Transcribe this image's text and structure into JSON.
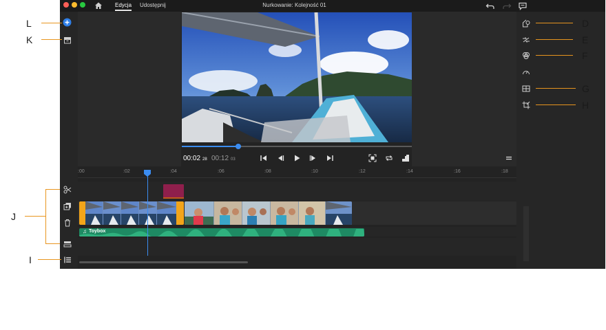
{
  "titlebar": {
    "tab_edit": "Edycja",
    "tab_share": "Udostępnij",
    "document_title": "Nurkowanie: Kolejność 01"
  },
  "colors": {
    "accent": "#3b8cf0",
    "callout": "#e8951f",
    "title_clip": "#8f1f4c",
    "audio_clip": "#1e8a63",
    "selected_clip": "#f2a51a"
  },
  "preview": {
    "current_time": "00:02",
    "current_frames": "28",
    "duration_time": "00:12",
    "duration_frames": "03",
    "playback_progress": 0.245
  },
  "timeline": {
    "ruler_ticks": [
      ":00",
      ":02",
      ":04",
      ":06",
      ":08",
      ":10",
      ":12",
      ":14",
      ":16",
      ":18"
    ],
    "audio_clip_name": "Toybox"
  },
  "callouts": {
    "left": [
      "L",
      "K",
      "J",
      "I"
    ],
    "right": [
      "D",
      "E",
      "F",
      "G",
      "H"
    ]
  },
  "icons": {
    "left_column": [
      "add-media-icon",
      "project-assets-icon",
      "split-icon",
      "duplicate-icon",
      "delete-icon",
      "detach-audio-icon",
      "track-list-icon"
    ],
    "right_column": [
      "shape-icon",
      "transition-icon",
      "color-icon",
      "speed-icon",
      "layout-icon",
      "crop-icon"
    ]
  }
}
